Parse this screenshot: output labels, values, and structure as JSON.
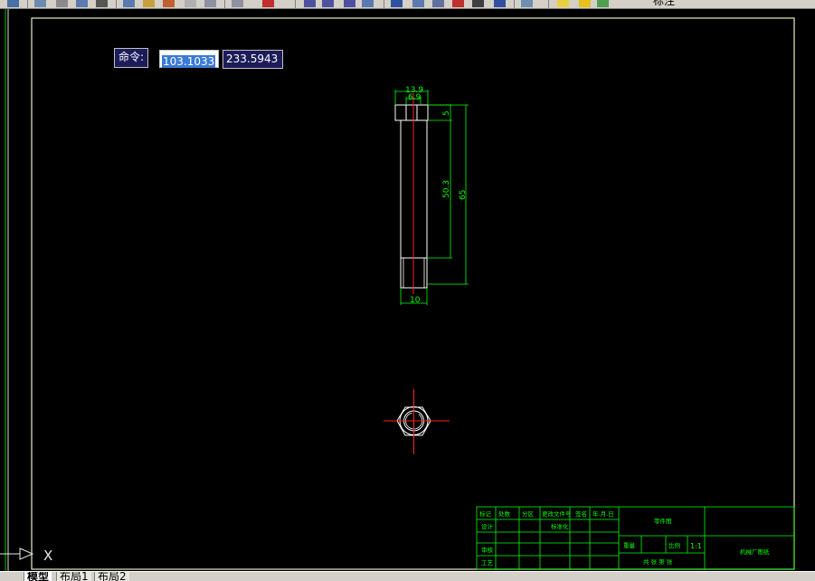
{
  "toolbar": {
    "icons": [
      "save-icon",
      "layer-icon",
      "properties-icon",
      "publish-icon",
      "cut-icon",
      "copy-icon",
      "paste-icon",
      "match-icon",
      "paint-icon",
      "undo-icon",
      "redo-icon",
      "pan-icon",
      "zoom-realtime-icon",
      "zoom-window-icon",
      "zoom-previous-icon",
      "designcenter-icon",
      "properties-palette-icon",
      "toolpalette-icon",
      "sheetset-icon",
      "markup-icon",
      "calculator-icon",
      "help-icon",
      "layer-manager-icon",
      "lightbulb-icon",
      "sun-icon",
      "color-swatch-icon"
    ],
    "style_label": "标注"
  },
  "command_input": {
    "label": "命令:",
    "x_value": "103.1033",
    "y_value": "233.5943"
  },
  "drawing": {
    "dimensions": {
      "top_outer": "13.9",
      "top_inner": "6.9",
      "head_height": "5",
      "thread_length": "50.3",
      "total_length": "65",
      "bottom_width": "10"
    },
    "title_block": {
      "cells": [
        "标记",
        "处数",
        "分区",
        "更改文件号",
        "签名",
        "年.月.日",
        "设计",
        "标准化",
        "审核",
        "工艺"
      ],
      "drawing_name": "零件图",
      "weight_label": "重量",
      "scale_label": "比例",
      "scale_value": "1:1",
      "sheet_text": "共 张 第 张",
      "company": "机械厂图纸"
    },
    "ucs_axis_label": "X"
  },
  "layout_tabs": [
    "模型",
    "布局1",
    "布局2"
  ],
  "colors": {
    "background": "#000000",
    "part_outline": "#ffffff",
    "centerline": "#ff2020",
    "dimension": "#00ff00",
    "frame": "#e8e8c0",
    "title_block": "#00ff00"
  }
}
